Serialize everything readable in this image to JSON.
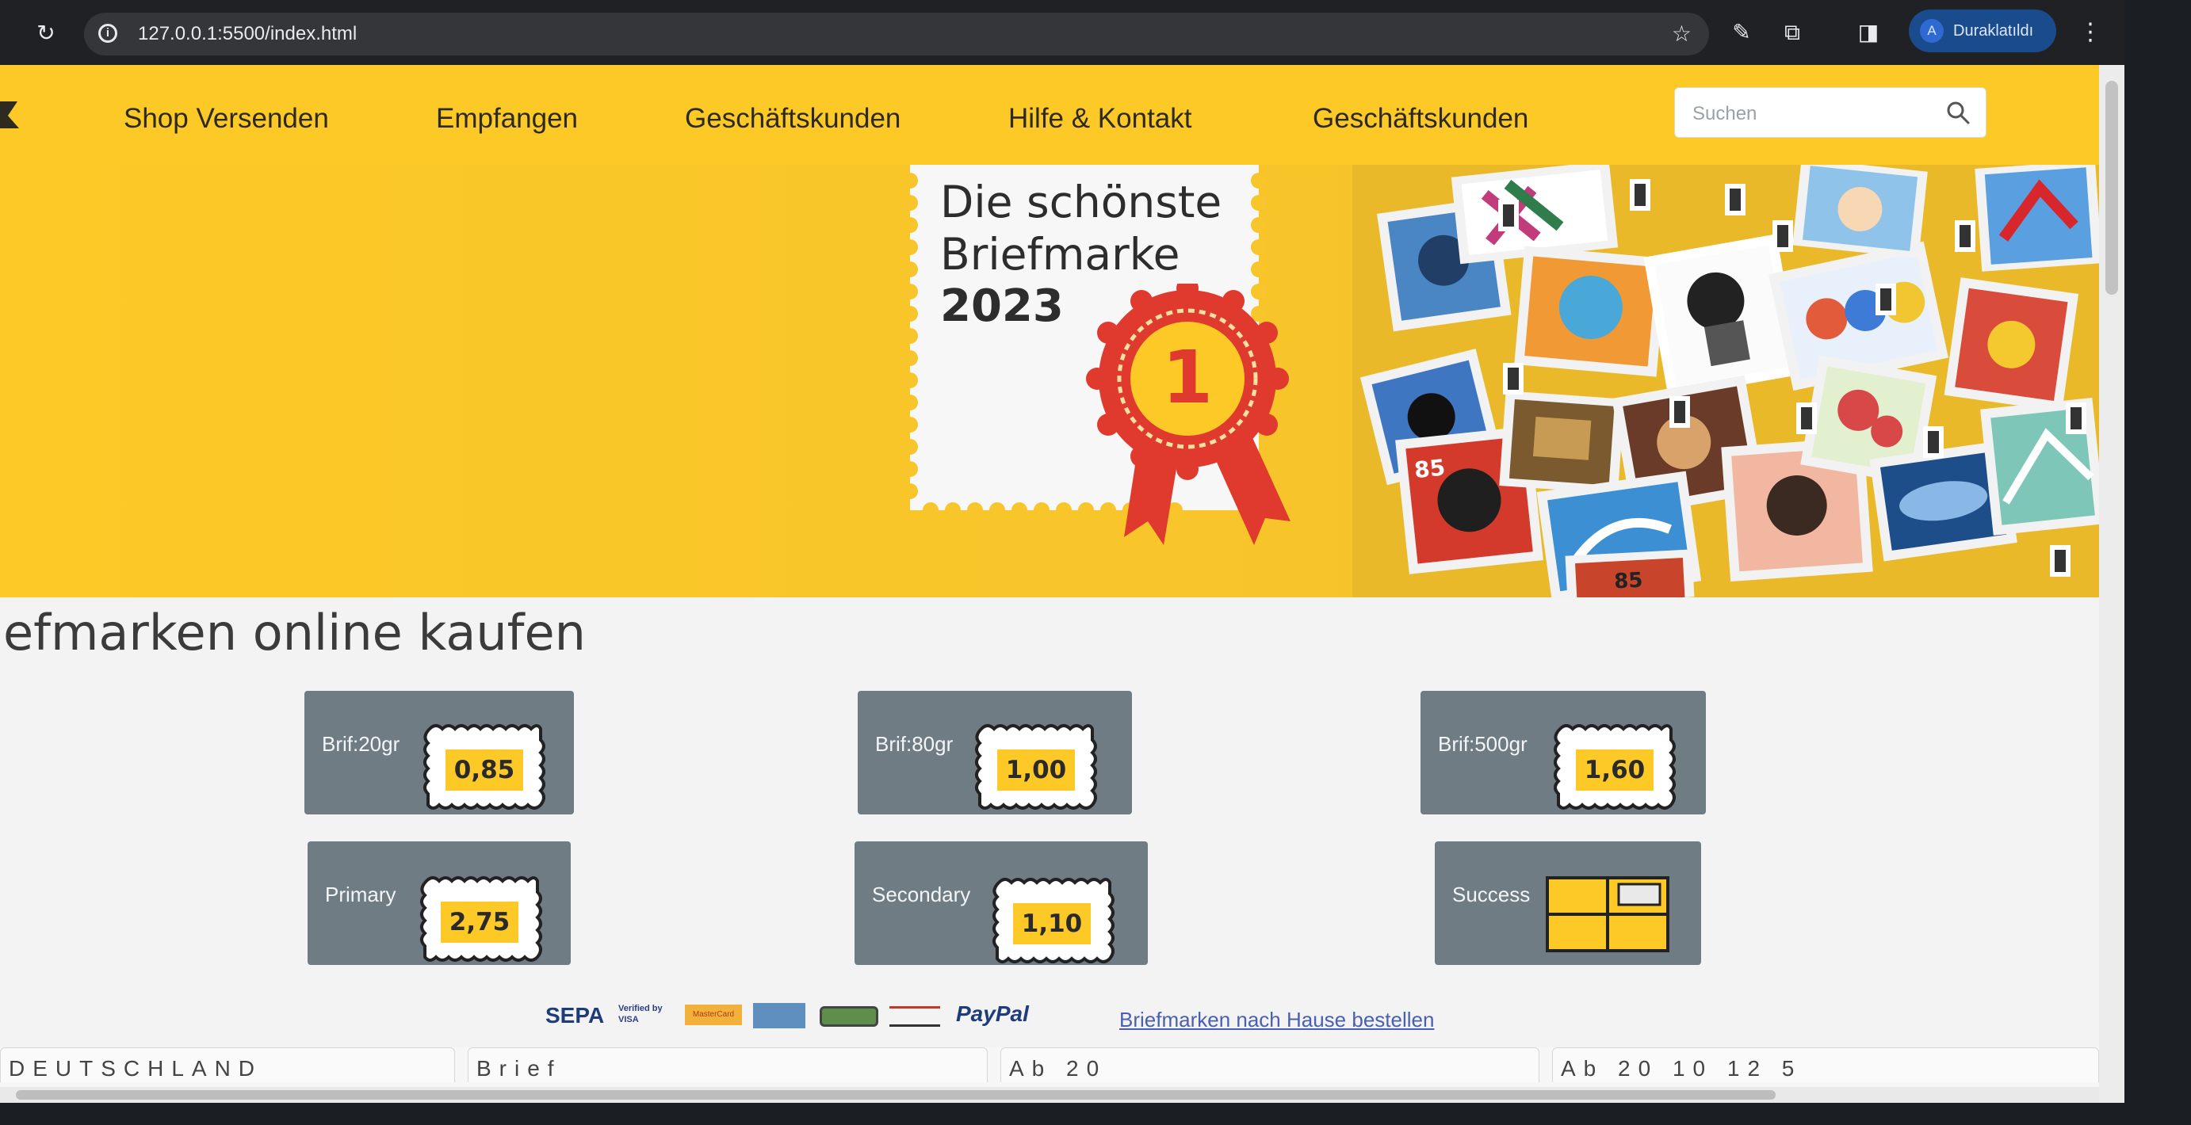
{
  "browser": {
    "url": "127.0.0.1:5500/index.html",
    "profile_initial": "A",
    "profile_name": "Duraklatıldı"
  },
  "nav": {
    "links": [
      "Shop Versenden",
      "Empfangen",
      "Geschäftskunden",
      "Hilfe & Kontakt",
      "Geschäftskunden"
    ],
    "search_placeholder": "Suchen"
  },
  "hero": {
    "title_line1": "Die schönste",
    "title_line2": "Briefmarke",
    "year": "2023",
    "rank": "1"
  },
  "main": {
    "headline": "efmarken online kaufen",
    "cards": [
      {
        "label": "Brif:20gr",
        "price": "0,85"
      },
      {
        "label": "Brif:80gr",
        "price": "1,00"
      },
      {
        "label": "Brif:500gr",
        "price": "1,60"
      },
      {
        "label": "Primary",
        "price": "2,75"
      },
      {
        "label": "Secondary",
        "price": "1,10"
      },
      {
        "label": "Success",
        "price": ""
      }
    ]
  },
  "payments": {
    "sepa": "SEPA",
    "verified": "Verified by VISA",
    "mastercard": "MasterCard",
    "paypal": "PayPal",
    "link": "Briefmarken nach Hause bestellen"
  },
  "footer_row": [
    "DEUTSCHLAND",
    "Brief",
    "Ab 20",
    "Ab 20 10 12 5"
  ],
  "colors": {
    "brand_yellow": "#fcc927",
    "card_gray": "#6f7c84",
    "rosette_red": "#e03a2f"
  }
}
